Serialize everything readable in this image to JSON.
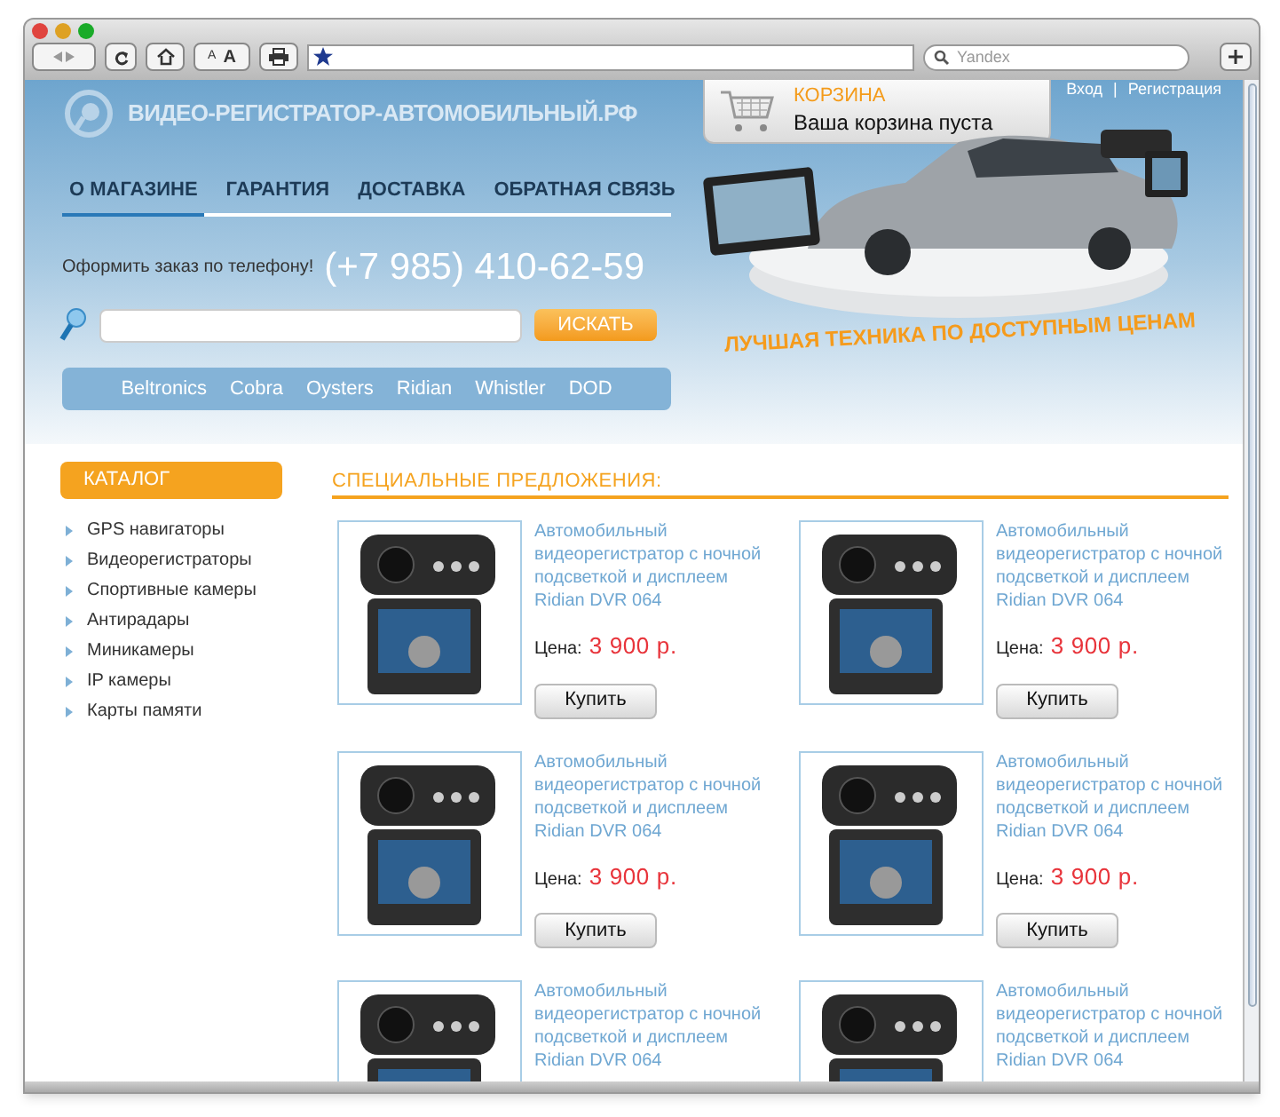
{
  "browser": {
    "search_placeholder": "Yandex",
    "text_size_small": "A",
    "text_size_large": "A"
  },
  "header": {
    "site_name": "ВИДЕО-РЕГИСТРАТОР-АВТОМОБИЛЬНЫЙ.РФ",
    "cart": {
      "title": "КОРЗИНА",
      "status": "Ваша корзина пуста"
    },
    "auth_links": [
      {
        "label": "Вход"
      },
      {
        "label": "Регистрация"
      }
    ],
    "auth_separator": "|"
  },
  "nav": [
    {
      "label": "О МАГАЗИНЕ",
      "selected": true
    },
    {
      "label": "ГАРАНТИЯ",
      "selected": false
    },
    {
      "label": "ДОСТАВКА",
      "selected": false
    },
    {
      "label": "ОБРАТНАЯ СВЯЗЬ",
      "selected": false
    }
  ],
  "phone": {
    "label": "Оформить заказ по телефону!",
    "number": "(+7 985) 410-62-59"
  },
  "search": {
    "button": "ИСКАТЬ"
  },
  "brands": [
    "Beltronics",
    "Cobra",
    "Oysters",
    "Ridian",
    "Whistler",
    "DOD"
  ],
  "slogan": "ЛУЧШАЯ ТЕХНИКА ПО ДОСТУПНЫМ ЦЕНАМ",
  "catalog": {
    "title": "КАТАЛОГ",
    "items": [
      "GPS навигаторы",
      "Видеорегистраторы",
      "Спортивные камеры",
      "Антирадары",
      "Миникамеры",
      "IP камеры",
      "Карты памяти"
    ]
  },
  "offers": {
    "title": "СПЕЦИАЛЬНЫЕ ПРЕДЛОЖЕНИЯ:",
    "products": [
      {
        "title": "Автомобильный видеорегистратор с ночной подсветкой и дисплеем Ridian DVR 064",
        "price_label": "Цена:",
        "price": "3 900 р.",
        "button": "Купить"
      },
      {
        "title": "Автомобильный видеорегистратор с ночной подсветкой и дисплеем Ridian DVR 064",
        "price_label": "Цена:",
        "price": "3 900 р.",
        "button": "Купить"
      },
      {
        "title": "Автомобильный видеорегистратор с ночной подсветкой и дисплеем Ridian DVR 064",
        "price_label": "Цена:",
        "price": "3 900 р.",
        "button": "Купить"
      },
      {
        "title": "Автомобильный видеорегистратор с ночной подсветкой и дисплеем Ridian DVR 064",
        "price_label": "Цена:",
        "price": "3 900 р.",
        "button": "Купить"
      },
      {
        "title": "Автомобильный видеорегистратор с ночной подсветкой и дисплеем Ridian DVR 064"
      },
      {
        "title": "Автомобильный видеорегистратор с ночной подсветкой и дисплеем Ridian DVR 064"
      }
    ]
  }
}
